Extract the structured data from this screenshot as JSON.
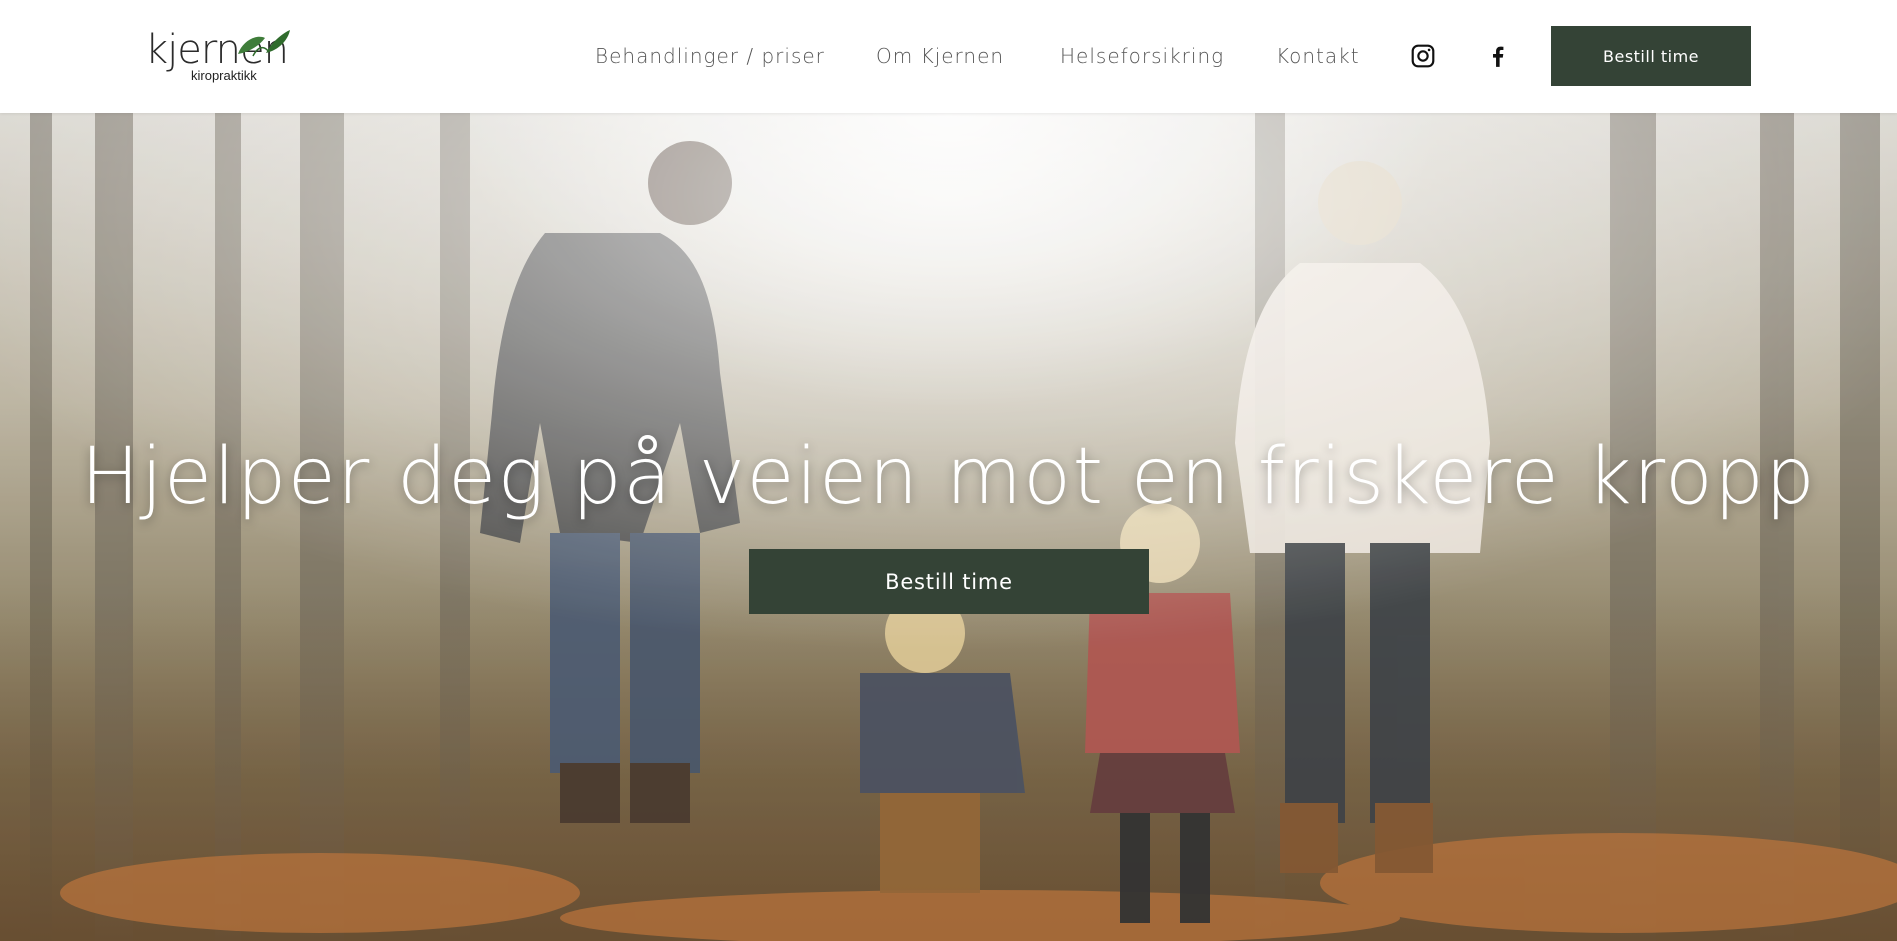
{
  "brand": {
    "name": "kjernen",
    "tagline": "kiropraktikk",
    "leaf_color": "#3f7d3a"
  },
  "nav": {
    "items": [
      {
        "label": "Behandlinger / priser"
      },
      {
        "label": "Om Kjernen"
      },
      {
        "label": "Helseforsikring"
      },
      {
        "label": "Kontakt"
      }
    ],
    "social": [
      {
        "icon": "instagram-icon"
      },
      {
        "icon": "facebook-icon"
      }
    ],
    "cta_label": "Bestill time"
  },
  "hero": {
    "title": "Hjelper deg på veien mot en friskere kropp",
    "cta_label": "Bestill time"
  },
  "colors": {
    "accent": "#344336",
    "header_bg": "#ffffff",
    "nav_text": "#555555"
  }
}
